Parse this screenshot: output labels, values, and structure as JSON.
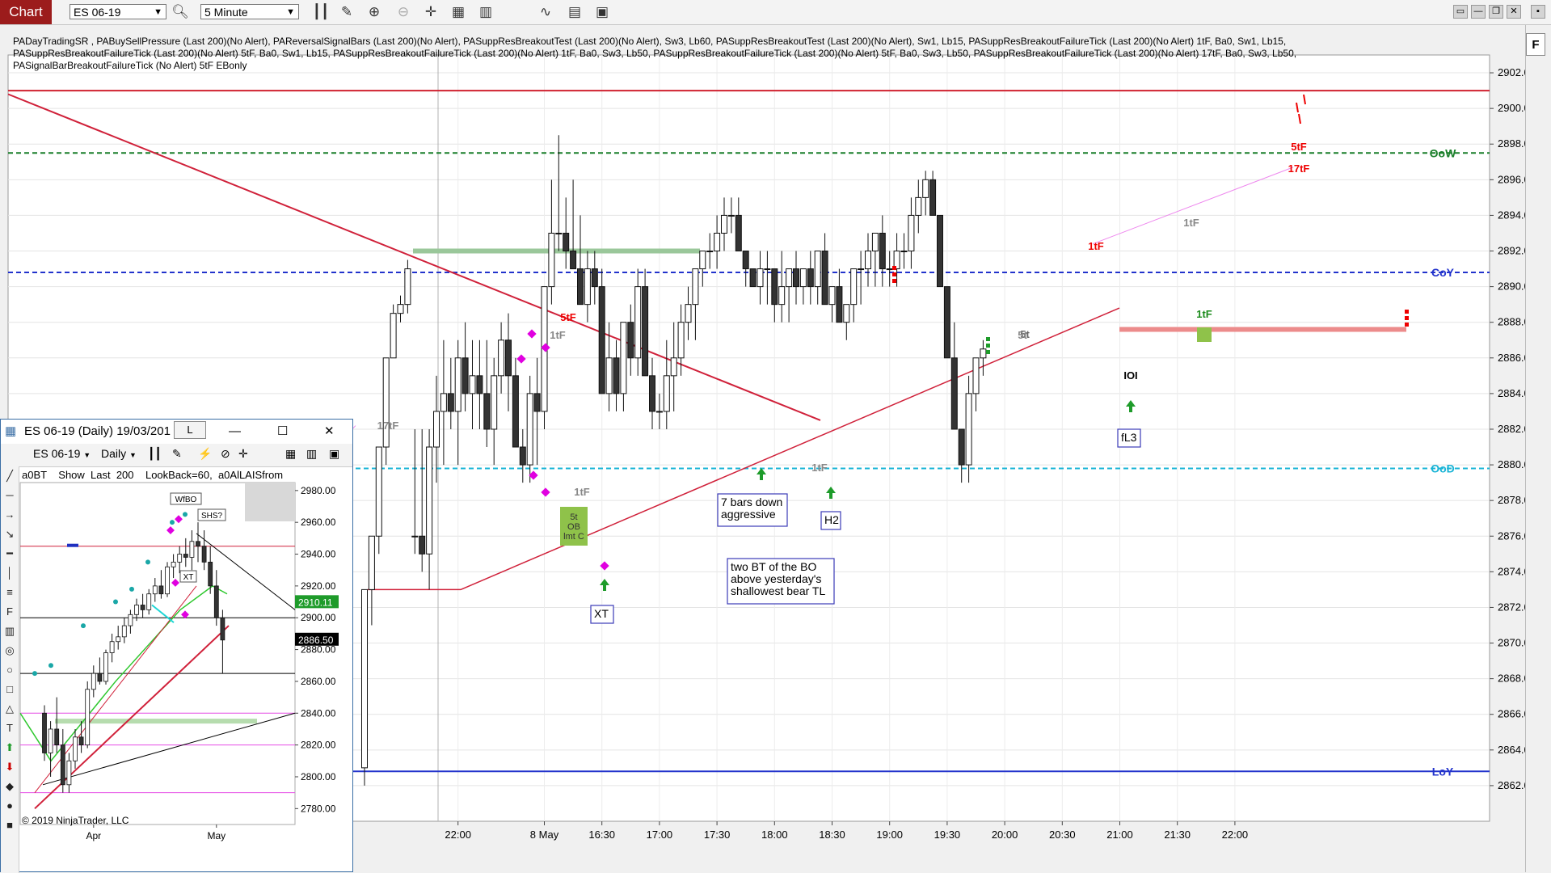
{
  "toolbar": {
    "tab_label": "Chart",
    "instrument": "ES 06-19",
    "interval": "5 Minute",
    "icons": [
      "bar-type-icon",
      "pencil-icon",
      "zoom-in-icon",
      "zoom-out-icon",
      "crosshair-icon",
      "data-box-icon",
      "strategy-icon",
      "indicators-icon",
      "properties-icon"
    ]
  },
  "indicator_text": [
    "PADayTradingSR , PABuySellPressure (Last 200)(No Alert), PAReversalSignalBars (Last 200)(No Alert), PASuppResBreakoutTest (Last 200)(No Alert),  Sw3,  Lb60, PASuppResBreakoutTest (Last 200)(No Alert),  Sw1,  Lb15, PASuppResBreakoutFailureTick (Last 200)(No Alert) 1tF,  Ba0,  Sw1,  Lb15,",
    "PASuppResBreakoutFailureTick (Last 200)(No Alert) 5tF,  Ba0,  Sw1,  Lb15, PASuppResBreakoutFailureTick (Last 200)(No Alert) 1tF,  Ba0,  Sw3,  Lb50, PASuppResBreakoutFailureTick (Last 200)(No Alert) 5tF,  Ba0,  Sw3,  Lb50, PASuppResBreakoutFailureTick (Last 200)(No Alert) 17tF,  Ba0,  Sw3,  Lb50,",
    "PASignalBarBreakoutFailureTick (No Alert)   5tF  EBonly"
  ],
  "chart_data": [
    {
      "type": "candlestick",
      "instrument": "ES 06-19",
      "interval": "5 Minute",
      "ylim": [
        2860,
        2903
      ],
      "yticks": [
        "2902.00",
        "2900.00",
        "2898.00",
        "2896.00",
        "2894.00",
        "2892.00",
        "2890.00",
        "2888.00",
        "2886.00",
        "2884.00",
        "2882.00",
        "2880.00",
        "2878.00",
        "2876.00",
        "2874.00",
        "2872.00",
        "2870.00",
        "2868.00",
        "2866.00",
        "2864.00",
        "2862.00"
      ],
      "xticks": [
        {
          "i": 13,
          "label": "22:00"
        },
        {
          "i": 25,
          "label": "8 May"
        },
        {
          "i": 33,
          "label": "16:30"
        },
        {
          "i": 41,
          "label": "17:00"
        },
        {
          "i": 49,
          "label": "17:30"
        },
        {
          "i": 57,
          "label": "18:00"
        },
        {
          "i": 65,
          "label": "18:30"
        },
        {
          "i": 73,
          "label": "19:00"
        },
        {
          "i": 81,
          "label": "19:30"
        },
        {
          "i": 89,
          "label": "20:00"
        },
        {
          "i": 97,
          "label": "20:30"
        },
        {
          "i": 105,
          "label": "21:00"
        },
        {
          "i": 113,
          "label": "21:30"
        },
        {
          "i": 121,
          "label": "22:00"
        }
      ],
      "candles": [
        [
          2863,
          2873,
          2862,
          2873
        ],
        [
          2873,
          2876,
          2871,
          2876
        ],
        [
          2876,
          2881,
          2875,
          2881
        ],
        [
          2881,
          2886,
          2880,
          2886
        ],
        [
          2886,
          2889,
          2886,
          2888.5
        ],
        [
          2888.5,
          2889.5,
          2888,
          2889
        ],
        [
          2889,
          2891.5,
          2888.5,
          2891
        ],
        [
          2876,
          2882,
          2875,
          2876
        ],
        [
          2876,
          2882,
          2874,
          2875
        ],
        [
          2875,
          2882,
          2873,
          2881
        ],
        [
          2881,
          2885,
          2879,
          2883
        ],
        [
          2883,
          2887,
          2880,
          2884
        ],
        [
          2884,
          2886,
          2882,
          2883
        ],
        [
          2883,
          2887,
          2880,
          2886
        ],
        [
          2886,
          2888,
          2883,
          2884
        ],
        [
          2884,
          2887,
          2882,
          2885
        ],
        [
          2885,
          2887,
          2882,
          2884
        ],
        [
          2884,
          2887,
          2881,
          2882
        ],
        [
          2882,
          2886,
          2880,
          2885
        ],
        [
          2885,
          2888,
          2884,
          2887
        ],
        [
          2887,
          2888.5,
          2883,
          2885
        ],
        [
          2885,
          2886,
          2881,
          2881
        ],
        [
          2881,
          2882,
          2879,
          2880
        ],
        [
          2880,
          2885,
          2879,
          2884
        ],
        [
          2884,
          2886,
          2880,
          2883
        ],
        [
          2883,
          2890,
          2882,
          2890
        ],
        [
          2890,
          2896,
          2889,
          2893
        ],
        [
          2893,
          2898.5,
          2892,
          2893
        ],
        [
          2893,
          2895,
          2891,
          2892
        ],
        [
          2892,
          2896,
          2891,
          2891
        ],
        [
          2891,
          2894,
          2889,
          2889
        ],
        [
          2889,
          2892,
          2888,
          2891
        ],
        [
          2891,
          2892,
          2889,
          2890
        ],
        [
          2890,
          2891,
          2884,
          2884
        ],
        [
          2884,
          2888,
          2883,
          2886
        ],
        [
          2886,
          2887,
          2883,
          2884
        ],
        [
          2884,
          2888,
          2883,
          2888
        ],
        [
          2888,
          2889,
          2885,
          2886
        ],
        [
          2886,
          2891,
          2885,
          2890
        ],
        [
          2890,
          2891,
          2886,
          2885
        ],
        [
          2885,
          2886,
          2882,
          2883
        ],
        [
          2883,
          2884,
          2882,
          2883
        ],
        [
          2883,
          2887,
          2882,
          2885
        ],
        [
          2885,
          2888,
          2883,
          2886
        ],
        [
          2886,
          2889,
          2885,
          2888
        ],
        [
          2888,
          2890,
          2887,
          2889
        ],
        [
          2889,
          2891,
          2887,
          2891
        ],
        [
          2891,
          2892,
          2890,
          2892
        ],
        [
          2892,
          2893,
          2891,
          2892
        ],
        [
          2892,
          2894,
          2891,
          2893
        ],
        [
          2893,
          2895,
          2892,
          2894
        ],
        [
          2894,
          2895,
          2893,
          2894
        ],
        [
          2894,
          2895,
          2892,
          2892
        ],
        [
          2892,
          2892,
          2890,
          2891
        ],
        [
          2891,
          2891,
          2890,
          2890
        ],
        [
          2890,
          2892,
          2889,
          2891
        ],
        [
          2891,
          2892,
          2889,
          2891
        ],
        [
          2891,
          2891,
          2888,
          2889
        ],
        [
          2889,
          2892,
          2888,
          2890
        ],
        [
          2890,
          2891,
          2888,
          2891
        ],
        [
          2891,
          2892,
          2889,
          2890
        ],
        [
          2890,
          2891,
          2889,
          2891
        ],
        [
          2891,
          2892,
          2889,
          2890
        ],
        [
          2890,
          2892,
          2889,
          2892
        ],
        [
          2892,
          2893,
          2889,
          2889
        ],
        [
          2889,
          2890,
          2888,
          2890
        ],
        [
          2890,
          2891,
          2888,
          2888
        ],
        [
          2888,
          2889,
          2887,
          2889
        ],
        [
          2889,
          2891,
          2888,
          2891
        ],
        [
          2891,
          2892,
          2889,
          2891
        ],
        [
          2891,
          2893,
          2890,
          2892
        ],
        [
          2892,
          2893,
          2890,
          2893
        ],
        [
          2893,
          2894,
          2890,
          2891
        ],
        [
          2891,
          2892,
          2890,
          2891
        ],
        [
          2891,
          2893,
          2890,
          2892
        ],
        [
          2892,
          2893,
          2891,
          2892
        ],
        [
          2892,
          2895,
          2891,
          2894
        ],
        [
          2894,
          2896,
          2893,
          2895
        ],
        [
          2895,
          2896.5,
          2894,
          2896
        ],
        [
          2896,
          2896.5,
          2894,
          2894
        ],
        [
          2894,
          2894,
          2890,
          2890
        ],
        [
          2890,
          2890,
          2886,
          2886
        ],
        [
          2886,
          2888,
          2882,
          2882
        ],
        [
          2882,
          2882,
          2879,
          2880
        ],
        [
          2880,
          2885,
          2879,
          2884
        ],
        [
          2884,
          2886,
          2883,
          2886
        ],
        [
          2886,
          2887,
          2885,
          2886.5
        ]
      ],
      "hlines": [
        {
          "y": 2901,
          "color": "#d0212f",
          "style": "solid"
        },
        {
          "y": 2897.5,
          "color": "#1a7f2a",
          "style": "dash",
          "label": "OoW"
        },
        {
          "y": 2890.8,
          "color": "#2233cc",
          "style": "dash",
          "label": "CoY"
        },
        {
          "y": 2879.8,
          "color": "#19b4d6",
          "style": "dash",
          "label": "OoD"
        },
        {
          "y": 2862.8,
          "color": "#2233cc",
          "style": "solid",
          "label": "LoY"
        }
      ],
      "annotations": [
        "17tF",
        "5tF",
        "1tF",
        "1tF",
        "5t",
        "1tF",
        "1tF",
        "1tF",
        "5tF",
        "17tF",
        "1tF",
        "IOI",
        "5t"
      ],
      "boxed_notes": [
        "XT",
        "7 bars down\naggressive",
        "H2",
        "two BT of the BO\nabove yesterday's\nshallowest bear TL",
        "fL3"
      ],
      "signal_box": "5t\nOB\nlmt C"
    },
    {
      "type": "candlestick",
      "window_title": "ES 06-19 (Daily)  19/03/201",
      "window_badge": "L",
      "instrument": "ES 06-19",
      "interval": "Daily",
      "header_text": "a0BT    Show  Last  200    LookBack=60,  a0AlLAISfrom",
      "ylim": [
        2770,
        2985
      ],
      "yticks": [
        "2980.00",
        "2960.00",
        "2940.00",
        "2920.00",
        "2900.00",
        "2880.00",
        "2860.00",
        "2840.00",
        "2820.00",
        "2800.00",
        "2780.00"
      ],
      "xticks": [
        {
          "i": 8,
          "label": "Apr"
        },
        {
          "i": 28,
          "label": "May"
        }
      ],
      "price_tags": [
        {
          "y": 2910.11,
          "label": "2910.11",
          "color": "#1e9b2a"
        },
        {
          "y": 2886.5,
          "label": "2886.50",
          "color": "#000"
        }
      ],
      "boxed_notes": [
        "WfBO",
        "SHS?",
        "XT"
      ],
      "copyright": "© 2019 NinjaTrader, LLC",
      "candles": [
        [
          2840,
          2845,
          2810,
          2815
        ],
        [
          2815,
          2835,
          2800,
          2830
        ],
        [
          2830,
          2850,
          2815,
          2820
        ],
        [
          2820,
          2830,
          2790,
          2795
        ],
        [
          2795,
          2815,
          2790,
          2810
        ],
        [
          2810,
          2830,
          2805,
          2825
        ],
        [
          2825,
          2835,
          2815,
          2820
        ],
        [
          2820,
          2860,
          2818,
          2855
        ],
        [
          2855,
          2870,
          2850,
          2865
        ],
        [
          2865,
          2875,
          2858,
          2860
        ],
        [
          2860,
          2880,
          2858,
          2878
        ],
        [
          2878,
          2890,
          2872,
          2885
        ],
        [
          2885,
          2895,
          2880,
          2888
        ],
        [
          2888,
          2900,
          2884,
          2895
        ],
        [
          2895,
          2905,
          2890,
          2902
        ],
        [
          2902,
          2912,
          2898,
          2908
        ],
        [
          2908,
          2915,
          2900,
          2905
        ],
        [
          2905,
          2918,
          2902,
          2915
        ],
        [
          2915,
          2925,
          2910,
          2920
        ],
        [
          2920,
          2930,
          2912,
          2915
        ],
        [
          2915,
          2935,
          2913,
          2932
        ],
        [
          2932,
          2940,
          2925,
          2935
        ],
        [
          2935,
          2945,
          2928,
          2940
        ],
        [
          2940,
          2950,
          2932,
          2938
        ],
        [
          2938,
          2955,
          2930,
          2948
        ],
        [
          2948,
          2960,
          2935,
          2945
        ],
        [
          2945,
          2955,
          2930,
          2935
        ],
        [
          2935,
          2945,
          2915,
          2920
        ],
        [
          2920,
          2930,
          2895,
          2900
        ],
        [
          2900,
          2905,
          2865,
          2886
        ]
      ]
    }
  ]
}
